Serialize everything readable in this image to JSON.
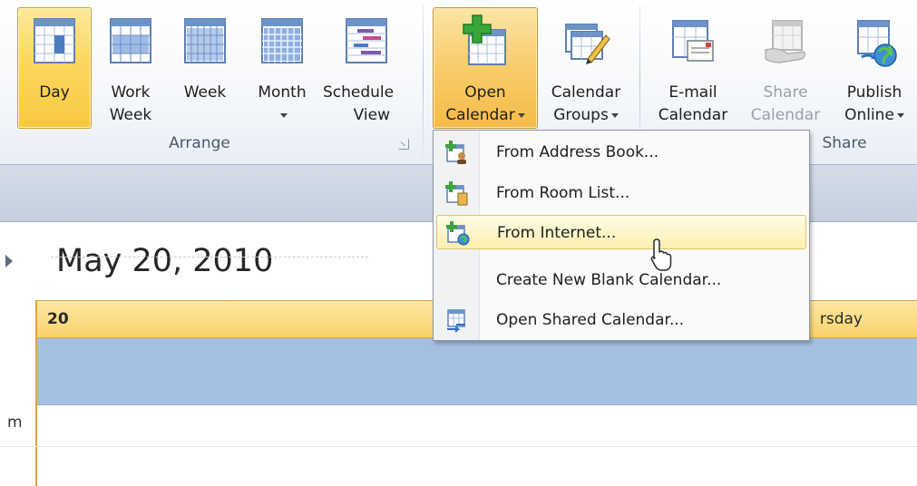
{
  "ribbon": {
    "buttons": [
      {
        "id": "day",
        "label": [
          "Day"
        ],
        "icon": "day-view-icon",
        "state": "active"
      },
      {
        "id": "work-week",
        "label": [
          "Work",
          "Week"
        ],
        "icon": "work-week-view-icon"
      },
      {
        "id": "week",
        "label": [
          "Week"
        ],
        "icon": "week-view-icon"
      },
      {
        "id": "month",
        "label": [
          "Month"
        ],
        "icon": "month-view-icon",
        "dropdown": true
      },
      {
        "id": "schedule-view",
        "label": [
          "Schedule",
          "View"
        ],
        "icon": "schedule-view-icon"
      },
      {
        "id": "open-calendar",
        "label": [
          "Open",
          "Calendar"
        ],
        "icon": "open-calendar-icon",
        "state": "pressed",
        "dropdown": true
      },
      {
        "id": "calendar-groups",
        "label": [
          "Calendar",
          "Groups"
        ],
        "icon": "calendar-groups-icon",
        "dropdown": true
      },
      {
        "id": "email-calendar",
        "label": [
          "E-mail",
          "Calendar"
        ],
        "icon": "email-calendar-icon"
      },
      {
        "id": "share-calendar",
        "label": [
          "Share",
          "Calendar"
        ],
        "icon": "share-calendar-icon",
        "state": "disabled"
      },
      {
        "id": "publish-online",
        "label": [
          "Publish",
          "Online"
        ],
        "icon": "publish-online-icon",
        "dropdown": true
      }
    ],
    "groups": {
      "arrange": "Arrange",
      "share": "Share"
    }
  },
  "calendar": {
    "date_title": "May 20, 2010",
    "day_number": "20",
    "day_name_partial": "rsday",
    "time_label_partial": "m"
  },
  "menu": {
    "items": [
      {
        "label": "From Address Book...",
        "icon": "address-book-icon"
      },
      {
        "label": "From Room List...",
        "icon": "room-list-icon"
      },
      {
        "label": "From Internet...",
        "icon": "internet-calendar-icon",
        "hover": true
      },
      {
        "label": "Create New Blank Calendar...",
        "icon": ""
      },
      {
        "label": "Open Shared Calendar...",
        "icon": "shared-calendar-icon"
      }
    ]
  },
  "colors": {
    "accent": "#f8c941",
    "allday": "#a5bfe0",
    "header": "#f8d36b"
  }
}
